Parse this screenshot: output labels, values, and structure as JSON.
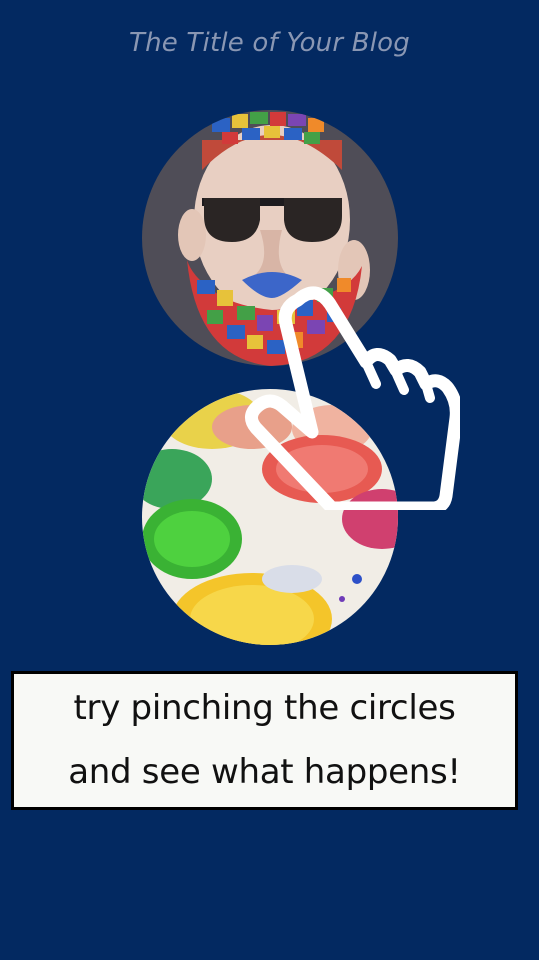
{
  "header": {
    "title": "The Title of Your Blog"
  },
  "images": [
    {
      "name": "bearded-man-portrait",
      "icon": "portrait-illustration"
    },
    {
      "name": "paint-palette",
      "icon": "paint-pots-photo"
    }
  ],
  "gesture": {
    "icon": "pointing-hand-icon"
  },
  "caption": {
    "line1": "try pinching the circles",
    "line2": "and see what happens!"
  },
  "colors": {
    "background": "#032961",
    "title": "#8a97b3",
    "caption_bg": "#f8f9f6"
  }
}
